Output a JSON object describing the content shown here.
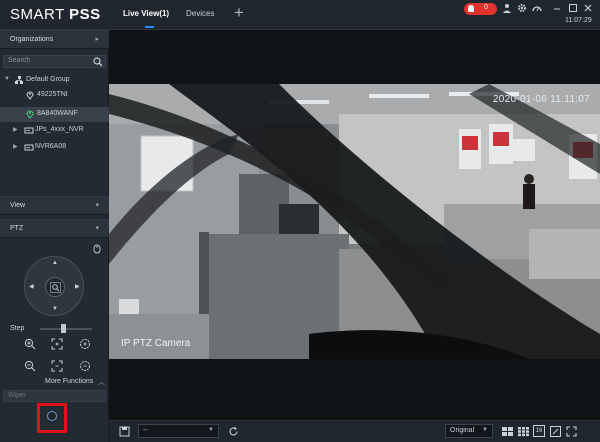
{
  "app": {
    "title_light": "SMART ",
    "title_bold": "PSS"
  },
  "tabs": [
    {
      "label": "Live View(1)"
    },
    {
      "label": "Devices"
    }
  ],
  "topbar": {
    "alarm_count": "0",
    "time": "11:07:29"
  },
  "sidebar": {
    "organizations_label": "Organizations",
    "search_placeholder": "Search",
    "tree": [
      {
        "label": "Default Group",
        "type": "group"
      },
      {
        "label": "49225TNI",
        "type": "camera"
      },
      {
        "label": "8A840WANF",
        "type": "camera",
        "selected": true
      },
      {
        "label": "JPs_4xxx_NVR",
        "type": "nvr"
      },
      {
        "label": "NVR6A08",
        "type": "nvr"
      }
    ],
    "view_label": "View",
    "ptz_label": "PTZ",
    "step_label": "Step",
    "step_value": 0.45,
    "more_functions_label": "More Functions",
    "wiper_label": "Wiper"
  },
  "video": {
    "timestamp": "2020-01-06 11:11:07",
    "camera_name": "IP PTZ Camera"
  },
  "bottombar": {
    "stream_value": "--",
    "view_mode": "Original",
    "grid_16_label": "16"
  },
  "colors": {
    "accent": "#2a8bff",
    "alarm": "#e2322d",
    "highlight": "#e2121b"
  }
}
